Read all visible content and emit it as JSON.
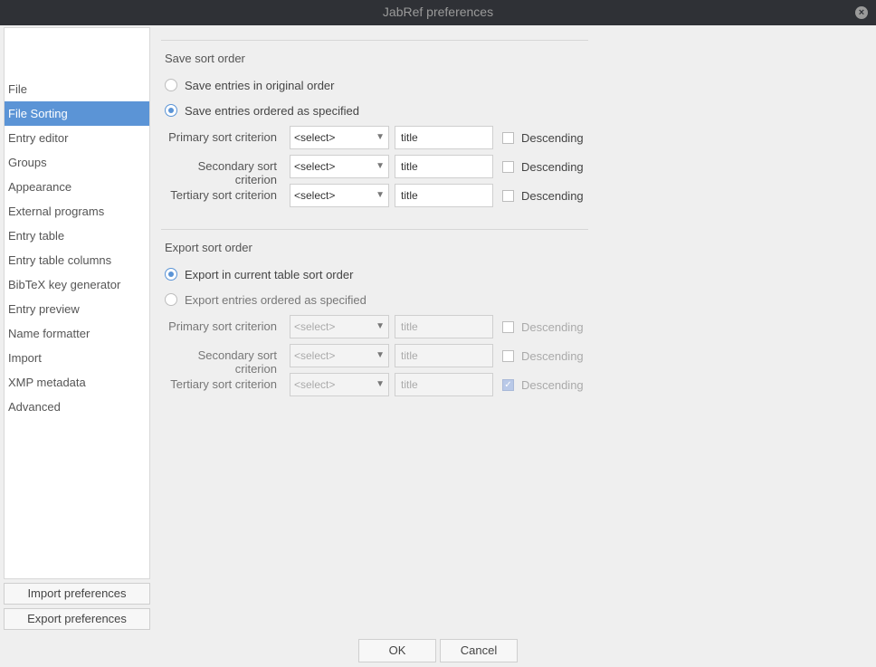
{
  "window": {
    "title": "JabRef preferences"
  },
  "sidebar": {
    "items": [
      {
        "label": "File"
      },
      {
        "label": "File Sorting",
        "selected": true
      },
      {
        "label": "Entry editor"
      },
      {
        "label": "Groups"
      },
      {
        "label": "Appearance"
      },
      {
        "label": "External programs"
      },
      {
        "label": "Entry table"
      },
      {
        "label": "Entry table columns"
      },
      {
        "label": "BibTeX key generator"
      },
      {
        "label": "Entry preview"
      },
      {
        "label": "Name formatter"
      },
      {
        "label": "Import"
      },
      {
        "label": "XMP metadata"
      },
      {
        "label": "Advanced"
      }
    ],
    "import_button": "Import preferences",
    "export_button": "Export preferences"
  },
  "save_group": {
    "title": "Save sort order",
    "option_original": "Save entries in original order",
    "option_specified": "Save entries ordered as specified",
    "selected": "specified",
    "criteria": [
      {
        "label": "Primary sort criterion",
        "combo": "<select>",
        "field": "title",
        "descending": "Descending",
        "descending_checked": false
      },
      {
        "label": "Secondary sort criterion",
        "combo": "<select>",
        "field": "title",
        "descending": "Descending",
        "descending_checked": false
      },
      {
        "label": "Tertiary sort criterion",
        "combo": "<select>",
        "field": "title",
        "descending": "Descending",
        "descending_checked": false
      }
    ]
  },
  "export_group": {
    "title": "Export sort order",
    "option_table": "Export in current table sort order",
    "option_specified": "Export entries ordered as specified",
    "selected": "table",
    "criteria": [
      {
        "label": "Primary sort criterion",
        "combo": "<select>",
        "field": "title",
        "descending": "Descending",
        "descending_checked": false
      },
      {
        "label": "Secondary sort criterion",
        "combo": "<select>",
        "field": "title",
        "descending": "Descending",
        "descending_checked": false
      },
      {
        "label": "Tertiary sort criterion",
        "combo": "<select>",
        "field": "title",
        "descending": "Descending",
        "descending_checked": true
      }
    ]
  },
  "buttons": {
    "ok": "OK",
    "cancel": "Cancel"
  },
  "colors": {
    "accent": "#5b94d6",
    "titlebar": "#2f3136",
    "background": "#efefef"
  },
  "icons": {
    "close": "close-icon",
    "dropdown": "chevron-down-icon"
  }
}
